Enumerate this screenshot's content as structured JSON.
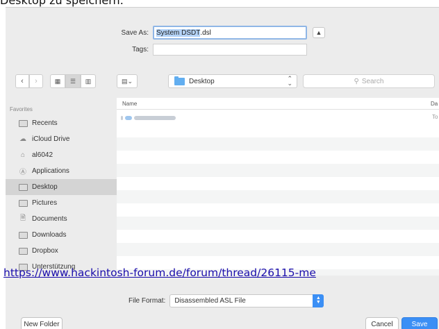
{
  "caption": {
    "top_text": "Desktop zu speichern."
  },
  "save_panel": {
    "save_as_label": "Save As:",
    "filename_selected": "System DSDT",
    "filename_ext": ".dsl",
    "tags_label": "Tags:",
    "tags_value": ""
  },
  "toolbar": {
    "location": "Desktop",
    "search_placeholder": "Search"
  },
  "sidebar": {
    "heading": "Favorites",
    "items": [
      {
        "label": "Recents",
        "icon": "recents-icon"
      },
      {
        "label": "iCloud Drive",
        "icon": "cloud-icon"
      },
      {
        "label": "al6042",
        "icon": "home-icon"
      },
      {
        "label": "Applications",
        "icon": "applications-icon"
      },
      {
        "label": "Desktop",
        "icon": "desktop-folder-icon",
        "selected": true
      },
      {
        "label": "Pictures",
        "icon": "pictures-folder-icon"
      },
      {
        "label": "Documents",
        "icon": "documents-icon"
      },
      {
        "label": "Downloads",
        "icon": "downloads-folder-icon"
      },
      {
        "label": "Dropbox",
        "icon": "dropbox-folder-icon"
      },
      {
        "label": "Unterstützung",
        "icon": "folder-icon"
      }
    ]
  },
  "file_list": {
    "col_name": "Name",
    "col_date": "Da",
    "rows": [
      {
        "date": "To"
      }
    ]
  },
  "watermark": {
    "url": "https://www.hackintosh-forum.de/forum/thread/26115-me"
  },
  "format": {
    "label": "File Format:",
    "value": "Disassembled ASL File"
  },
  "buttons": {
    "new_folder": "New Folder",
    "cancel": "Cancel",
    "save": "Save"
  },
  "colors": {
    "accent": "#3b8ff5",
    "selection": "#b4d3f7",
    "link": "#1a0dab"
  }
}
